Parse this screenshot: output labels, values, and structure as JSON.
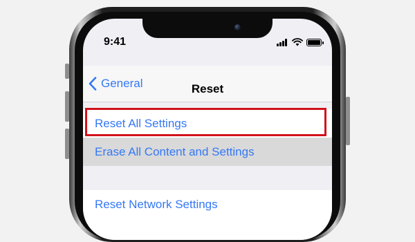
{
  "status_bar": {
    "time": "9:41"
  },
  "nav": {
    "back_label": "General",
    "title": "Reset"
  },
  "groups": [
    {
      "rows": [
        {
          "label": "Reset All Settings",
          "highlighted": false
        },
        {
          "label": "Erase All Content and Settings",
          "highlighted": true
        }
      ]
    },
    {
      "rows": [
        {
          "label": "Reset Network Settings",
          "highlighted": false
        }
      ]
    }
  ],
  "annotation": {
    "color": "#d0121b",
    "target": "Reset All Settings"
  },
  "colors": {
    "accent": "#3478f6",
    "background": "#efeff4"
  }
}
